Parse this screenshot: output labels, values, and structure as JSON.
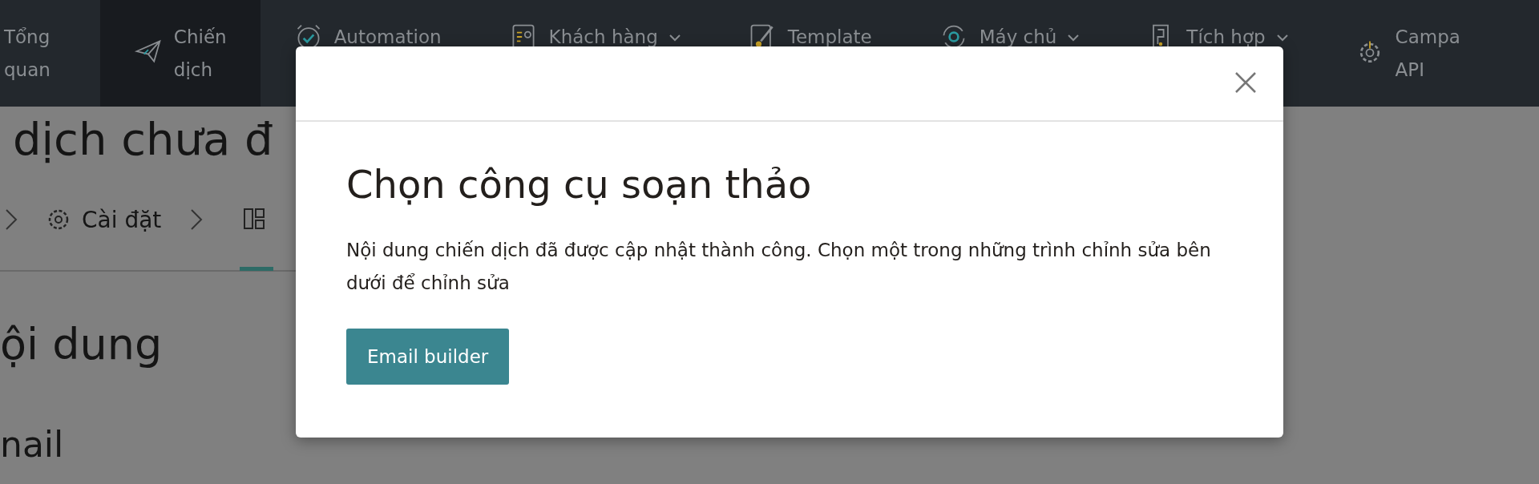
{
  "nav": {
    "items": [
      {
        "label": "Tổng quan",
        "selected": false,
        "dropdown": false
      },
      {
        "label": "Chiến dịch",
        "selected": true,
        "dropdown": false
      },
      {
        "label": "Automation",
        "selected": false,
        "dropdown": false
      },
      {
        "label": "Khách hàng",
        "selected": false,
        "dropdown": true
      },
      {
        "label": "Template",
        "selected": false,
        "dropdown": false
      },
      {
        "label": "Máy chủ",
        "selected": false,
        "dropdown": true
      },
      {
        "label": "Tích hợp",
        "selected": false,
        "dropdown": true
      },
      {
        "label": "Campa API",
        "selected": false,
        "dropdown": false
      }
    ]
  },
  "page": {
    "title": "dịch chưa đ",
    "breadcrumb": [
      {
        "kind": "chevron"
      },
      {
        "label": "Cài đặt",
        "kind": "settings"
      },
      {
        "kind": "chevron"
      },
      {
        "kind": "layout",
        "selected": true
      }
    ],
    "section_title": "ội dung",
    "subsection_title": "nail"
  },
  "modal": {
    "title": "Chọn công cụ soạn thảo",
    "message": "Nội dung chiến dịch đã được cập nhật thành công. Chọn một trong những trình chỉnh sửa bên dưới để chỉnh sửa",
    "buttons": [
      "Email builder"
    ]
  }
}
